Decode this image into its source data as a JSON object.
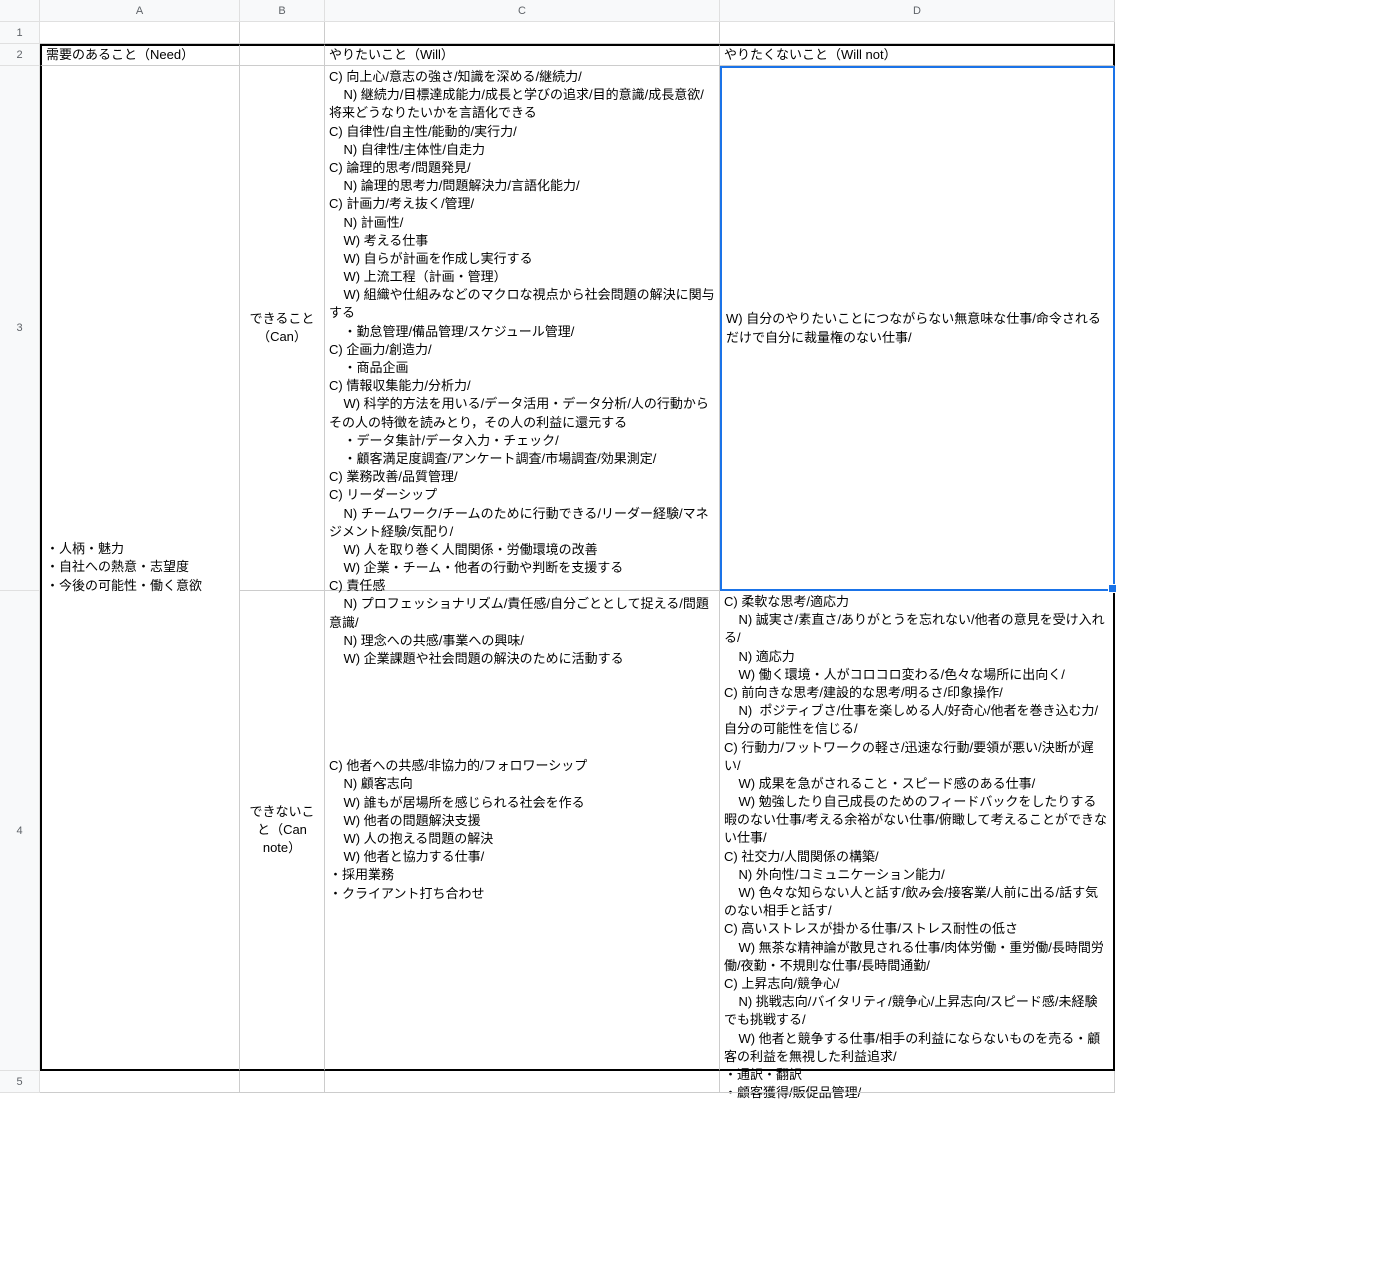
{
  "columns": {
    "A": "A",
    "B": "B",
    "C": "C",
    "D": "D"
  },
  "rows": {
    "r1": "1",
    "r2": "2",
    "r3": "3",
    "r4": "4",
    "r5": "5"
  },
  "headers": {
    "A2": "需要のあること（Need）",
    "C2": "やりたいこと（Will）",
    "D2": "やりたくないこと（Will not）"
  },
  "sidebar": {
    "A34": "・人柄・魅力\n・自社への熱意・志望度\n・今後の可能性・働く意欲",
    "B3": "できること（Can）",
    "B4": "できないこと（Can note）"
  },
  "content": {
    "C3": "C) 向上心/意志の強さ/知識を深める/継続力/\n    N) 継続力/目標達成能力/成長と学びの追求/目的意識/成長意欲/将来どうなりたいかを言語化できる\nC) 自律性/自主性/能動的/実行力/\n    N) 自律性/主体性/自走力\nC) 論理的思考/問題発見/\n    N) 論理的思考力/問題解決力/言語化能力/\nC) 計画力/考え抜く/管理/\n    N) 計画性/\n    W) 考える仕事\n    W) 自らが計画を作成し実行する\n    W) 上流工程（計画・管理）\n    W) 組織や仕組みなどのマクロな視点から社会問題の解決に関与する\n    ・勤怠管理/備品管理/スケジュール管理/\nC) 企画力/創造力/\n    ・商品企画\nC) 情報収集能力/分析力/\n    W) 科学的方法を用いる/データ活用・データ分析/人の行動からその人の特徴を読みとり，その人の利益に還元する\n    ・データ集計/データ入力・チェック/\n    ・顧客満足度調査/アンケート調査/市場調査/効果測定/\nC) 業務改善/品質管理/\nC) リーダーシップ\n    N) チームワーク/チームのために行動できる/リーダー経験/マネジメント経験/気配り/\n    W) 人を取り巻く人間関係・労働環境の改善\n    W) 企業・チーム・他者の行動や判断を支援する\nC) 責任感\n    N) プロフェッショナリズム/責任感/自分ごととして捉える/問題意識/\n    N) 理念への共感/事業への興味/\n    W) 企業課題や社会問題の解決のために活動する",
    "D3": "W) 自分のやりたいことにつながらない無意味な仕事/命令されるだけで自分に裁量権のない仕事/",
    "C4": "C) 他者への共感/非協力的/フォロワーシップ\n    N) 顧客志向\n    W) 誰もが居場所を感じられる社会を作る\n    W) 他者の問題解決支援\n    W) 人の抱える問題の解決\n    W) 他者と協力する仕事/\n・採用業務\n・クライアント打ち合わせ",
    "D4": "C) 柔軟な思考/適応力\n    N) 誠実さ/素直さ/ありがとうを忘れない/他者の意見を受け入れる/\n    N) 適応力\n    W) 働く環境・人がコロコロ変わる/色々な場所に出向く/\nC) 前向きな思考/建設的な思考/明るさ/印象操作/\n    N)  ポジティブさ/仕事を楽しめる人/好奇心/他者を巻き込む力/自分の可能性を信じる/\nC) 行動力/フットワークの軽さ/迅速な行動/要領が悪い/決断が遅い/\n    W) 成果を急がされること・スピード感のある仕事/\n    W) 勉強したり自己成長のためのフィードバックをしたりする暇のない仕事/考える余裕がない仕事/俯瞰して考えることができない仕事/\nC) 社交力/人間関係の構築/\n    N) 外向性/コミュニケーション能力/\n    W) 色々な知らない人と話す/飲み会/接客業/人前に出る/話す気のない相手と話す/\nC) 高いストレスが掛かる仕事/ストレス耐性の低さ\n    W) 無茶な精神論が散見される仕事/肉体労働・重労働/長時間労働/夜勤・不規則な仕事/長時間通勤/\nC) 上昇志向/競争心/\n    N) 挑戦志向/バイタリティ/競争心/上昇志向/スピード感/未経験でも挑戦する/\n    W) 他者と競争する仕事/相手の利益にならないものを売る・顧客の利益を無視した利益追求/\n・通訳・翻訳\n・顧客獲得/販促品管理/"
  }
}
